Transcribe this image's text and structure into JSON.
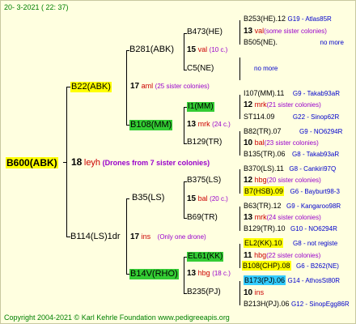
{
  "header": {
    "date": "20-  3-2021 (  22: 37)"
  },
  "footer": {
    "copyright": "Copyright 2004-2021 © Karl Kehrle Foundation",
    "site": "www.pedigreeapis.org"
  },
  "root": {
    "name": "B600(ABK)",
    "num": "18",
    "code": "leyh",
    "note": "(Drones from 7 sister colonies)"
  },
  "upper": {
    "b22": {
      "name": "B22(ABK)",
      "num": "17",
      "code": "aml",
      "note": "(25 sister colonies)"
    },
    "b281": {
      "name": "B281(ABK)",
      "num": "15",
      "code": "val",
      "note": "(10 c.)"
    },
    "b473": {
      "name": "B473(HE)"
    },
    "c5": {
      "name": "C5(NE)"
    },
    "b473_r": [
      {
        "name": "B253(HE).12",
        "link": "G19 - Atlas85R"
      },
      {
        "num": "13",
        "code": "val",
        "note": "(some sister colonies)"
      },
      {
        "name": "B505(NE).",
        "link": "no more"
      }
    ],
    "c5_r": {
      "text": "no more"
    },
    "b108": {
      "name": "B108(MM)",
      "num": "13",
      "code": "mrk",
      "note": "(24 c.)"
    },
    "i1": {
      "name": "I1(MM)"
    },
    "b129": {
      "name": "B129(TR)"
    },
    "i1_r": [
      {
        "name": "I107(MM).11",
        "link": "G9 - Takab93aR"
      },
      {
        "num": "12",
        "code": "mrk",
        "note": "(21 sister colonies)"
      },
      {
        "name": "ST114.09",
        "link": "G22 - Sinop62R"
      }
    ],
    "b129_r": [
      {
        "name": "B82(TR).07",
        "link": "G9 - NO6294R"
      },
      {
        "num": "10",
        "code": "bal",
        "note": "(23 sister colonies)"
      },
      {
        "name": "B135(TR).06",
        "link": "G8 - Takab93aR"
      }
    ]
  },
  "lower": {
    "b114": {
      "name": "B114(LS)1dr",
      "num": "17",
      "code": "ins",
      "note": "(Only one drone)"
    },
    "b35": {
      "name": "B35(LS)",
      "num": "15",
      "code": "bal",
      "note": "(20 c.)"
    },
    "b375": {
      "name": "B375(LS)"
    },
    "b69": {
      "name": "B69(TR)"
    },
    "b375_r": [
      {
        "name": "B370(LS).11",
        "link": "G8 - Cankiri97Q"
      },
      {
        "num": "12",
        "code": "hbg",
        "note": "(20 sister colonies)"
      },
      {
        "name": "B7(HSB).09",
        "link": "G6 - Bayburt98-3"
      }
    ],
    "b69_r": [
      {
        "name": "B63(TR).12",
        "link": "G9 - Kangaroo98R"
      },
      {
        "num": "13",
        "code": "mrk",
        "note": "(24 sister colonies)"
      },
      {
        "name": "B129(TR).10",
        "link": "G10 - NO6294R"
      }
    ],
    "b14": {
      "name": "B14V(RHO)",
      "num": "13",
      "code": "hbg",
      "note": "(18 c.)"
    },
    "el61": {
      "name": "EL61(KK)"
    },
    "b235": {
      "name": "B235(PJ)"
    },
    "el61_r": [
      {
        "name": "EL2(KK).10",
        "link": "G8 - not registe"
      },
      {
        "num": "11",
        "code": "hbg",
        "note": "(22 sister colonies)"
      },
      {
        "name": "B108(CHP).08",
        "link": "G6 - B262(NE)"
      }
    ],
    "b235_r": [
      {
        "name": "B173(PJ).06",
        "link": "G14 - AthosSt80R"
      },
      {
        "num": "10",
        "code": "ins",
        "note": ""
      },
      {
        "name": "B213H(PJ).06",
        "link": "G12 - SinopEgg86R"
      }
    ]
  },
  "colors": {
    "background": "#ffffe0",
    "yellow": "#ffff00",
    "green": "#33cc33",
    "cyan": "#33ccff",
    "red": "#cc0000",
    "blue": "#0000cc",
    "purple": "#9900cc"
  }
}
